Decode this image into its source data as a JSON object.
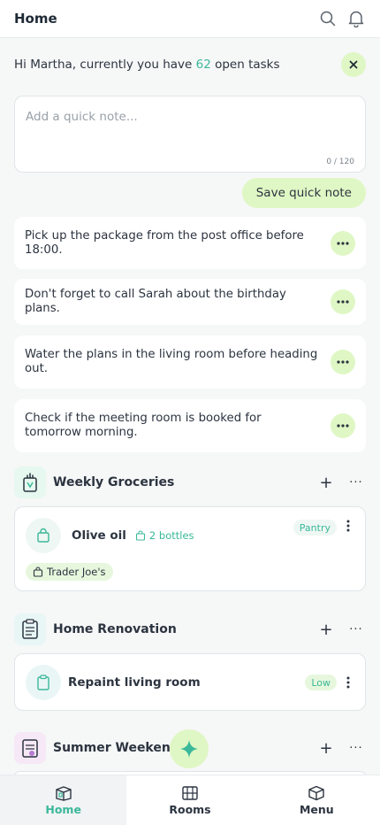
{
  "header": {
    "title": "Home",
    "icons": [
      "search-icon",
      "bell-icon"
    ]
  },
  "greeting": {
    "prefix": "Hi Martha, currently you have ",
    "count": "62",
    "suffix": " open tasks"
  },
  "quick_note": {
    "placeholder": "Add a quick note...",
    "counter": "0 / 120",
    "save_label": "Save quick note"
  },
  "notes": [
    {
      "text": "Pick up the package from the post office before 18:00."
    },
    {
      "text": "Don't forget to call Sarah about the birthday plans."
    },
    {
      "text": "Water the plans in the living room before heading out."
    },
    {
      "text": "Check if the meeting room is booked for tomorrow morning."
    }
  ],
  "sections": [
    {
      "title": "Weekly Groceries",
      "item": {
        "name": "Olive oil",
        "quantity": "2 bottles",
        "badge": "Pantry",
        "tag": "Trader Joe's"
      }
    },
    {
      "title": "Home Renovation",
      "item": {
        "name": "Repaint living room",
        "badge": "Low"
      }
    },
    {
      "title": "Summer Weekends"
    }
  ],
  "nav": [
    {
      "label": "Home",
      "active": true
    },
    {
      "label": "Rooms"
    },
    {
      "label": "Menu"
    }
  ],
  "colors": {
    "accent": "#3bb89a",
    "accent_light": "#dff7c4",
    "text": "#2c3440"
  }
}
